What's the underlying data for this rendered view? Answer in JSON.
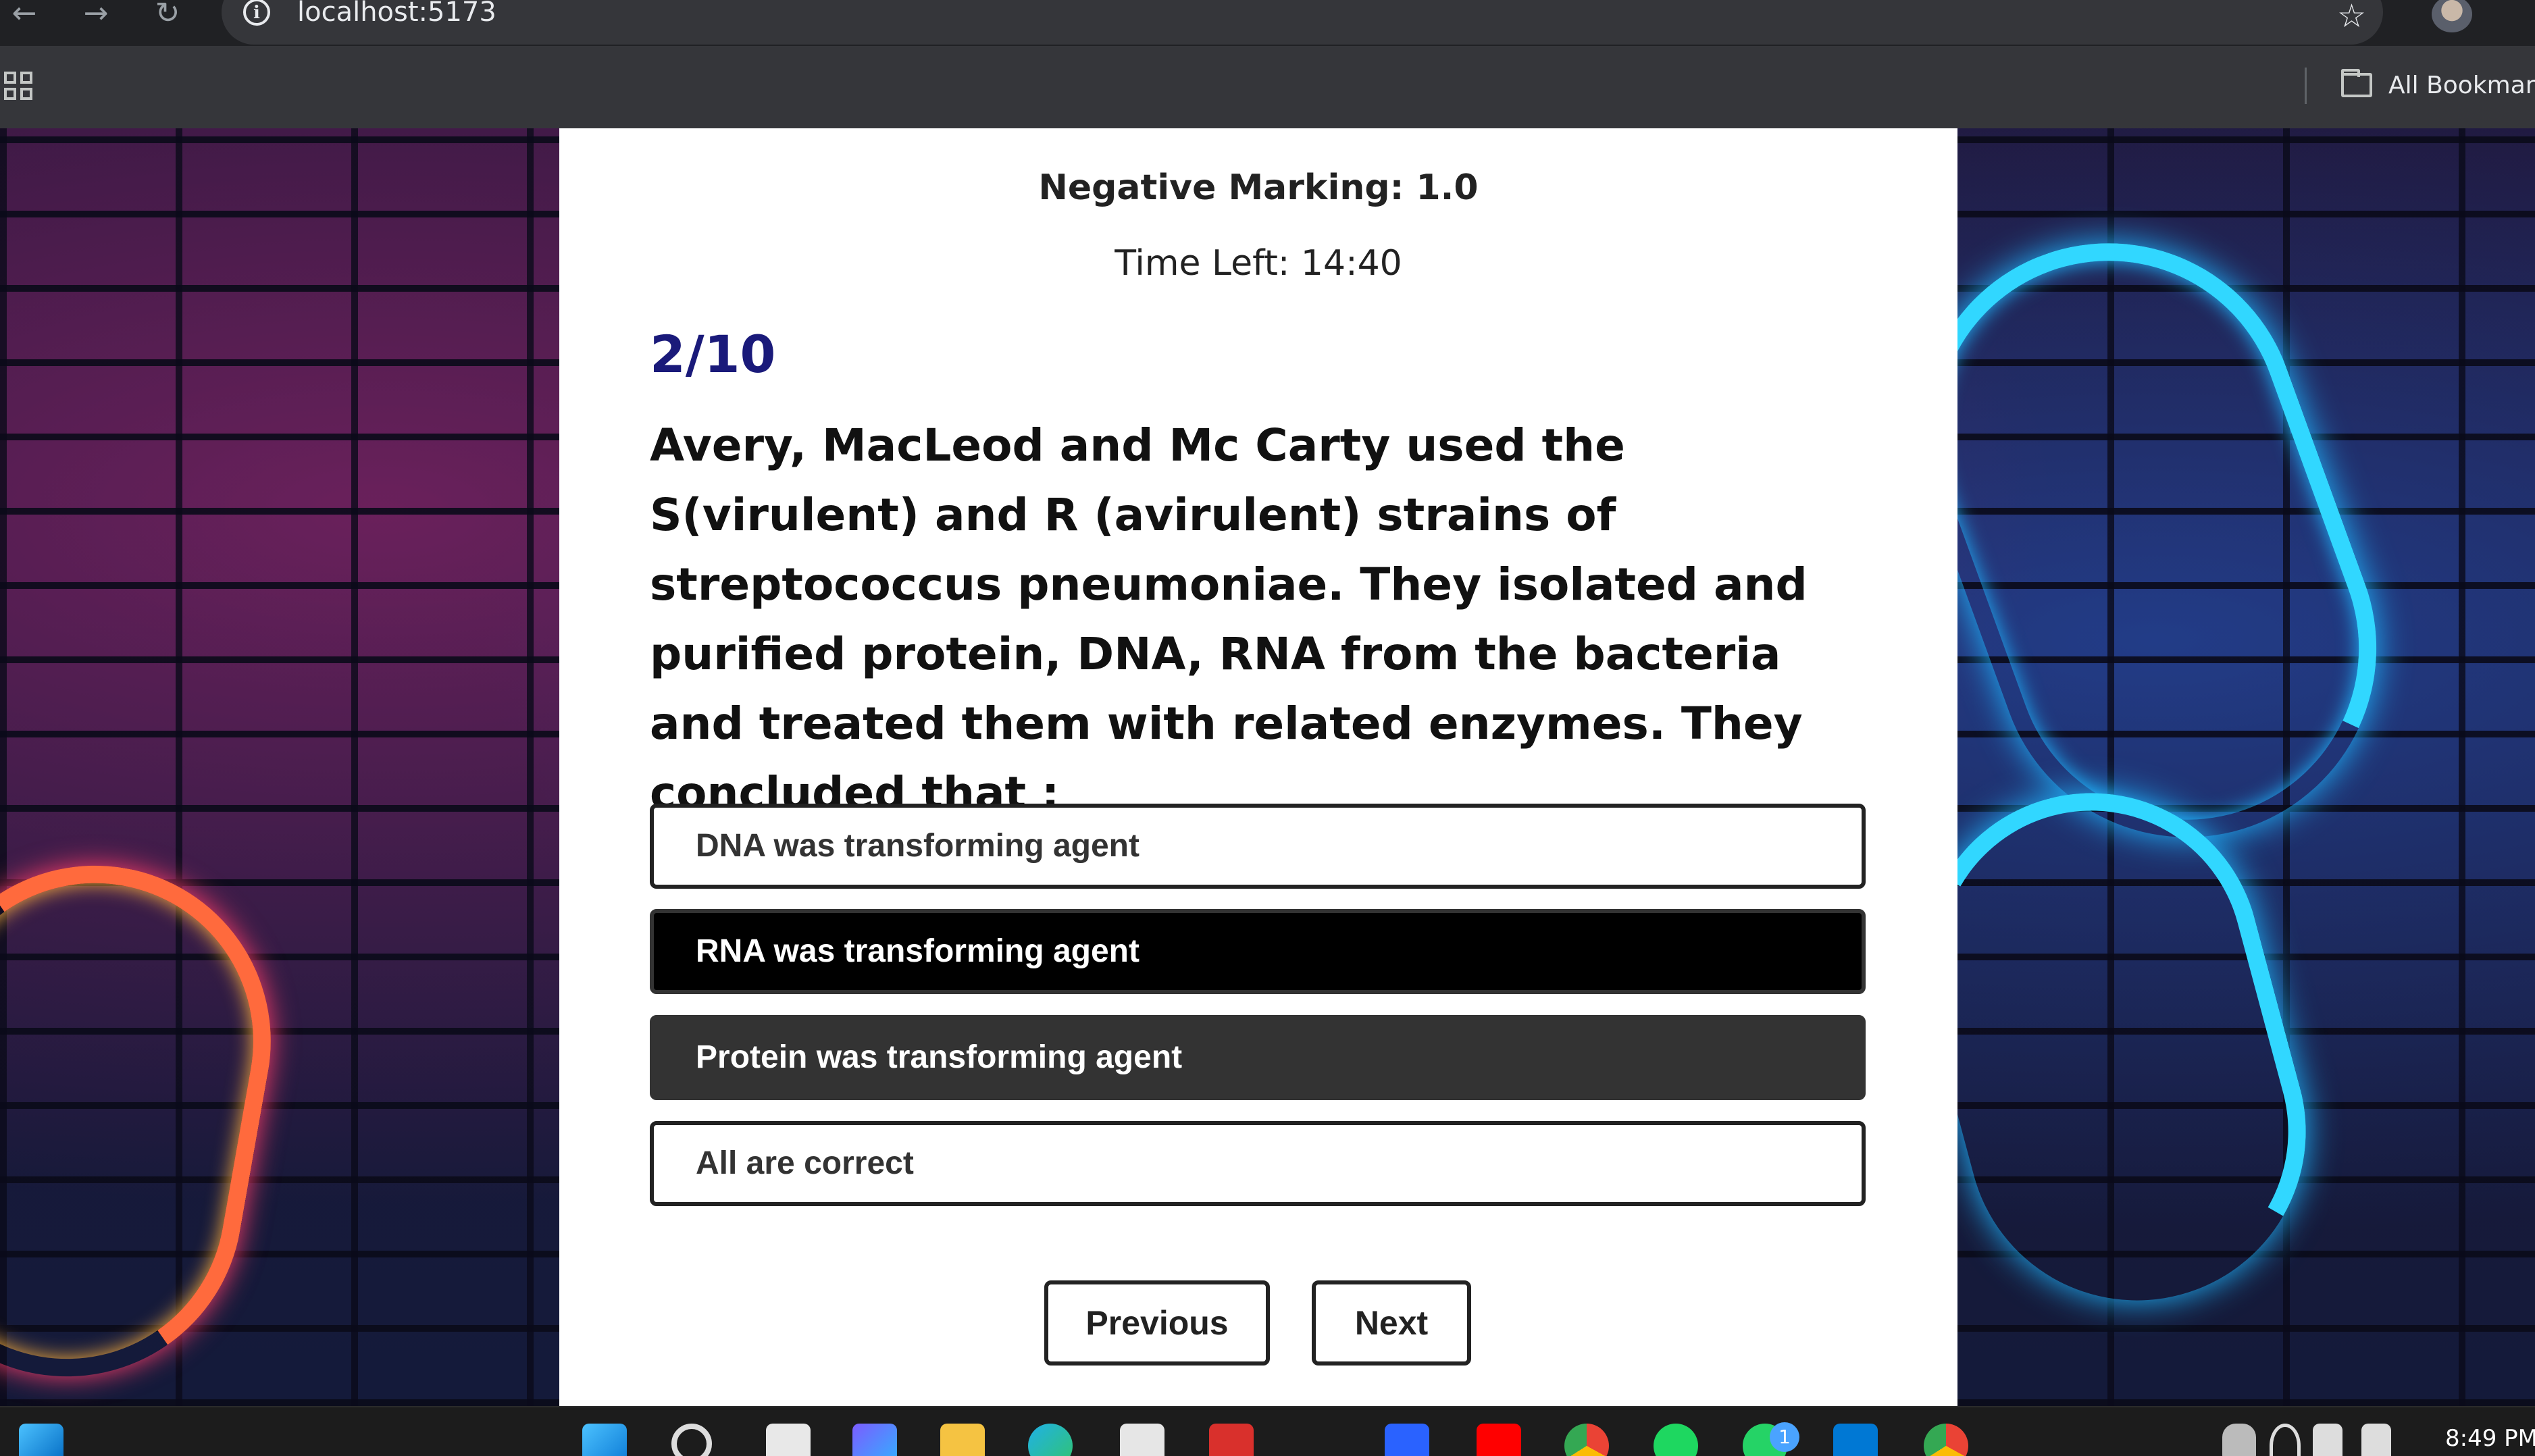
{
  "browser": {
    "url": "localhost:5173",
    "bookmarks_label": "All Bookmarks",
    "icons": {
      "back": "←",
      "forward": "→",
      "reload": "↻",
      "info": "i",
      "star": "☆"
    }
  },
  "quiz": {
    "negative_marking": "Negative Marking: 1.0",
    "time_left": "Time Left: 14:40",
    "counter": "2/10",
    "question": "Avery, MacLeod and Mc Carty used the S(virulent) and R (avirulent) strains of streptococcus pneumoniae. They isolated and purified protein, DNA, RNA from the bacteria and treated them with related enzymes. They concluded that :",
    "options": [
      {
        "label": "DNA was transforming agent"
      },
      {
        "label": "RNA was transforming agent"
      },
      {
        "label": "Protein was transforming agent"
      },
      {
        "label": "All are correct"
      }
    ],
    "previous_label": "Previous",
    "next_label": "Next"
  },
  "taskbar": {
    "clock": "8:49 PM",
    "notification_badge": "1"
  }
}
